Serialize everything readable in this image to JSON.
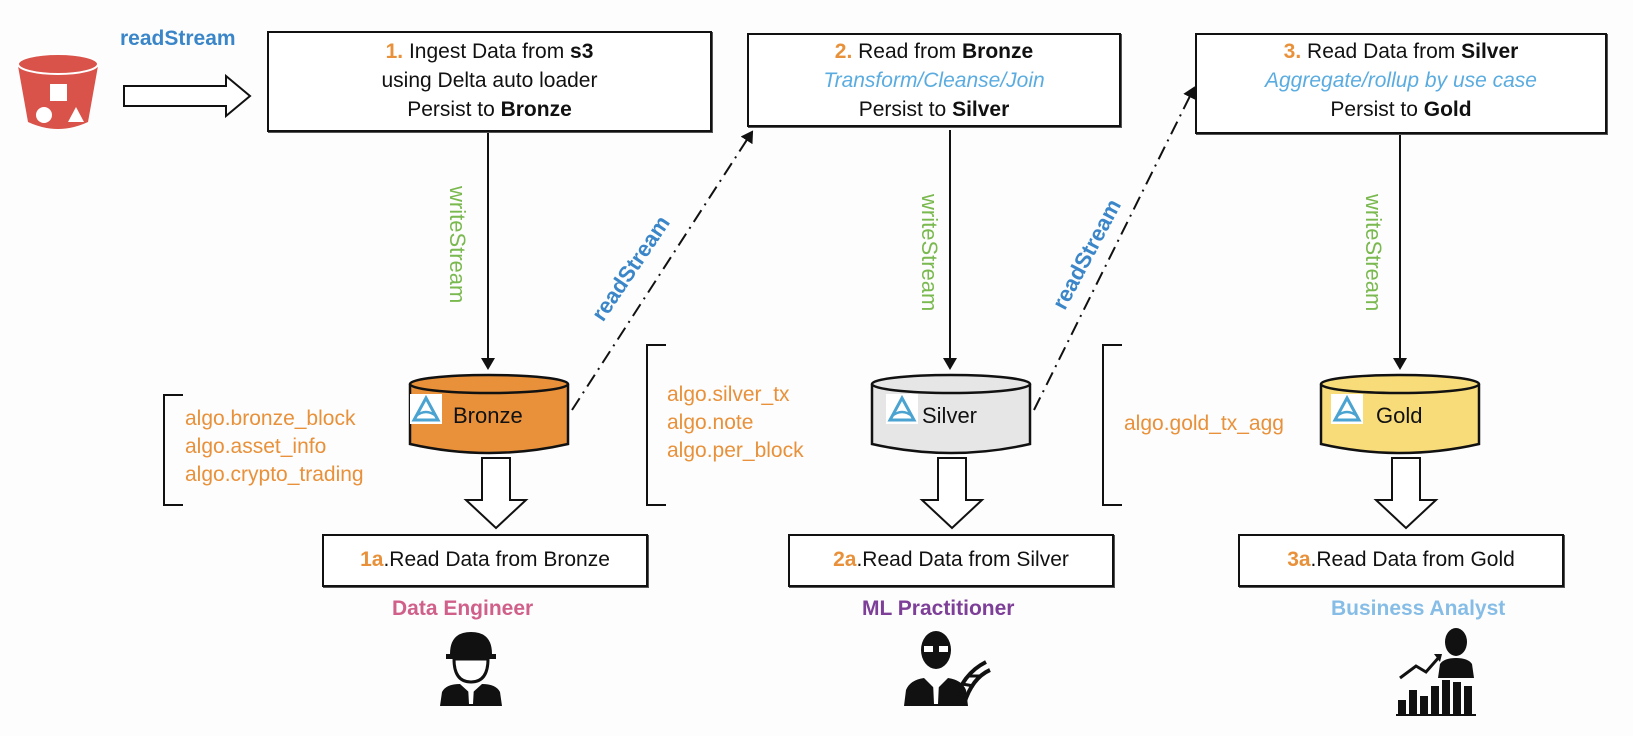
{
  "source": {
    "icon": "s3-bucket-icon",
    "read_label": "readStream"
  },
  "steps": [
    {
      "number": "1.",
      "lines": [
        {
          "pre": "Ingest Data from ",
          "bold": "s3"
        },
        {
          "plain": "using Delta auto loader"
        },
        {
          "pre": "Persist to ",
          "bold": "Bronze"
        }
      ]
    },
    {
      "number": "2.",
      "lines": [
        {
          "pre": "Read from ",
          "bold": "Bronze"
        },
        {
          "italic": "Transform/Cleanse/Join"
        },
        {
          "pre": "Persist to ",
          "bold": "Silver"
        }
      ]
    },
    {
      "number": "3.",
      "lines": [
        {
          "pre": "Read Data from ",
          "bold": "Silver"
        },
        {
          "italic": "Aggregate/rollup  by use case"
        },
        {
          "pre": "Persist to ",
          "bold": "Gold"
        }
      ]
    }
  ],
  "write_label": "writeStream",
  "read_label": "readStream",
  "layers": [
    {
      "name": "Bronze",
      "color": "#e8913a",
      "tables": [
        "algo.bronze_block",
        "algo.asset_info",
        "algo.crypto_trading"
      ]
    },
    {
      "name": "Silver",
      "color": "#e6e6e6",
      "tables": [
        "algo.silver_tx",
        "algo.note",
        "algo.per_block"
      ]
    },
    {
      "name": "Gold",
      "color": "#f9dc7a",
      "tables": [
        "algo.gold_tx_agg"
      ]
    }
  ],
  "consumers": [
    {
      "number": "1a",
      "text": ".Read Data from Bronze",
      "persona": "Data Engineer",
      "persona_color": "#d0608a",
      "icon": "data-engineer-icon"
    },
    {
      "number": "2a",
      "text": ".Read Data from Silver",
      "persona": "ML Practitioner",
      "persona_color": "#7d3f98",
      "icon": "ml-practitioner-icon"
    },
    {
      "number": "3a",
      "text": ".Read Data from Gold",
      "persona": "Business Analyst",
      "persona_color": "#86bde6",
      "icon": "business-analyst-icon"
    }
  ],
  "colors": {
    "accent_orange": "#e8913a",
    "write_green": "#7ab94f",
    "read_blue": "#3a86c8",
    "italic_blue": "#5aace0",
    "s3_red": "#d9534a"
  }
}
